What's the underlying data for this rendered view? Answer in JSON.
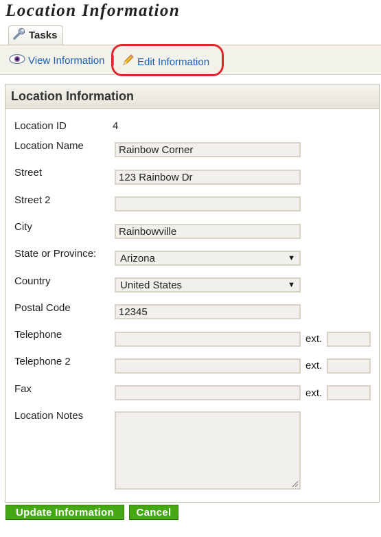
{
  "page": {
    "title": "Location Information"
  },
  "tabs": [
    {
      "label": "Tasks",
      "icon": "wrench-icon"
    }
  ],
  "toolbar": {
    "view_label": "View Information",
    "separator": "|",
    "edit_label": "Edit Information"
  },
  "panel": {
    "header": "Location Information"
  },
  "form": {
    "location_id_label": "Location ID",
    "location_id_value": "4",
    "location_name_label": "Location Name",
    "location_name_value": "Rainbow Corner",
    "street_label": "Street",
    "street_value": "123 Rainbow Dr",
    "street2_label": "Street 2",
    "street2_value": "",
    "city_label": "City",
    "city_value": "Rainbowville",
    "state_label": "State or Province:",
    "state_value": "Arizona",
    "country_label": "Country",
    "country_value": "United States",
    "postal_label": "Postal Code",
    "postal_value": "12345",
    "telephone_label": "Telephone",
    "telephone2_label": "Telephone 2",
    "fax_label": "Fax",
    "ext_label": "ext.",
    "notes_label": "Location Notes"
  },
  "buttons": {
    "update_label": "Update Information",
    "cancel_label": "Cancel"
  },
  "colors": {
    "link": "#1a5fb4",
    "button": "#43a814",
    "highlight": "#e0252b"
  }
}
